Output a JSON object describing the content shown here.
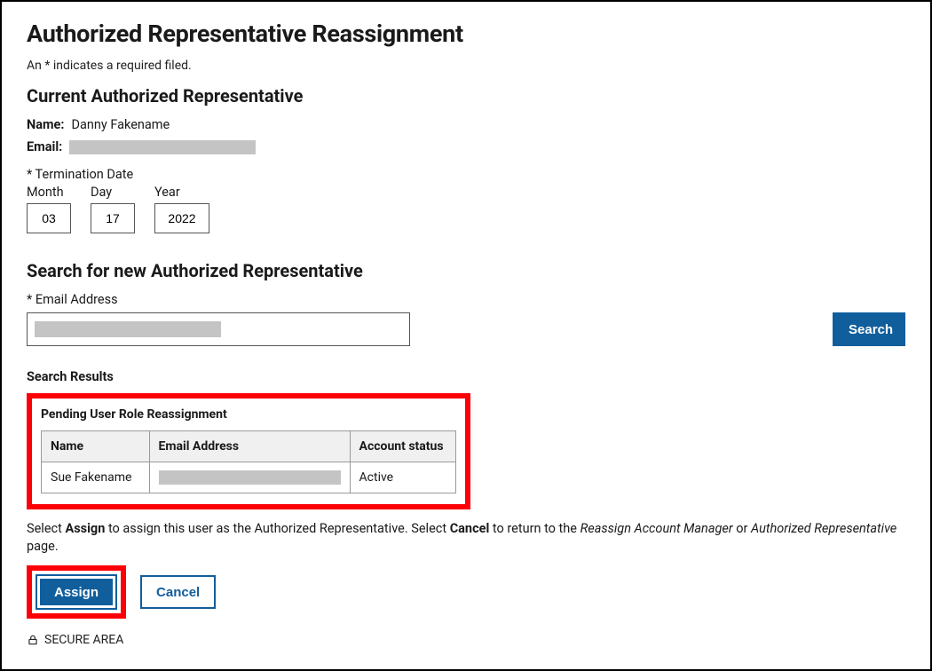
{
  "page": {
    "title": "Authorized Representative Reassignment",
    "required_hint": "An * indicates a required filed."
  },
  "current": {
    "heading": "Current Authorized Representative",
    "name_label": "Name:",
    "name_value": "Danny Fakename",
    "email_label": "Email:",
    "email_value": "",
    "termination_label": "* Termination Date",
    "date_headers": {
      "month": "Month",
      "day": "Day",
      "year": "Year"
    },
    "date_values": {
      "month": "03",
      "day": "17",
      "year": "2022"
    }
  },
  "search": {
    "heading": "Search for new Authorized Representative",
    "email_label": "* Email Address",
    "email_value": "",
    "button": "Search"
  },
  "results": {
    "heading": "Search Results",
    "pending_title": "Pending User Role Reassignment",
    "columns": {
      "name": "Name",
      "email": "Email Address",
      "status": "Account status"
    },
    "rows": [
      {
        "name": "Sue Fakename",
        "email": "",
        "status": "Active"
      }
    ]
  },
  "instructions": {
    "prefix": "Select ",
    "assign_word": "Assign",
    "mid1": " to assign this user as the Authorized Representative. Select ",
    "cancel_word": "Cancel",
    "mid2": " to return to the ",
    "italic1": "Reassign Account Manager",
    "or": " or ",
    "italic2": "Authorized Representative",
    "suffix": " page."
  },
  "actions": {
    "assign": "Assign",
    "cancel": "Cancel"
  },
  "footer": {
    "secure": "SECURE AREA"
  }
}
